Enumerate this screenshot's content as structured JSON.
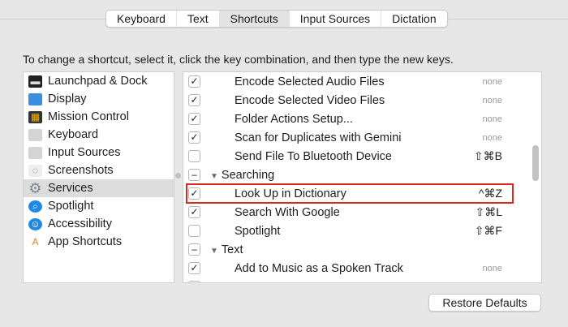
{
  "tabs": [
    "Keyboard",
    "Text",
    "Shortcuts",
    "Input Sources",
    "Dictation"
  ],
  "selected_tab": "Shortcuts",
  "instruction": "To change a shortcut, select it, click the key combination, and then type the new keys.",
  "categories": [
    {
      "label": "Launchpad & Dock",
      "icon": "launchpad-icon"
    },
    {
      "label": "Display",
      "icon": "display-icon"
    },
    {
      "label": "Mission Control",
      "icon": "mission-control-icon"
    },
    {
      "label": "Keyboard",
      "icon": "keyboard-icon"
    },
    {
      "label": "Input Sources",
      "icon": "input-sources-icon"
    },
    {
      "label": "Screenshots",
      "icon": "screenshots-icon"
    },
    {
      "label": "Services",
      "icon": "gear-icon"
    },
    {
      "label": "Spotlight",
      "icon": "spotlight-icon"
    },
    {
      "label": "Accessibility",
      "icon": "accessibility-icon"
    },
    {
      "label": "App Shortcuts",
      "icon": "app-shortcuts-icon"
    }
  ],
  "selected_category": "Services",
  "shortcuts": [
    {
      "label": "Encode Selected Audio Files",
      "checked": true,
      "shortcut": "none"
    },
    {
      "label": "Encode Selected Video Files",
      "checked": true,
      "shortcut": "none"
    },
    {
      "label": "Folder Actions Setup...",
      "checked": true,
      "shortcut": "none"
    },
    {
      "label": "Scan for Duplicates with Gemini",
      "checked": true,
      "shortcut": "none"
    },
    {
      "label": "Send File To Bluetooth Device",
      "checked": false,
      "shortcut": "⇧⌘B"
    },
    {
      "label": "Searching",
      "group": true
    },
    {
      "label": "Look Up in Dictionary",
      "checked": true,
      "shortcut": "^⌘Z",
      "highlighted": true
    },
    {
      "label": "Search With Google",
      "checked": true,
      "shortcut": "⇧⌘L"
    },
    {
      "label": "Spotlight",
      "checked": false,
      "shortcut": "⇧⌘F"
    },
    {
      "label": "Text",
      "group": true
    },
    {
      "label": "Add to Music as a Spoken Track",
      "checked": true,
      "shortcut": "none"
    }
  ],
  "restore_defaults": "Restore Defaults",
  "accent": "#d82a1e"
}
